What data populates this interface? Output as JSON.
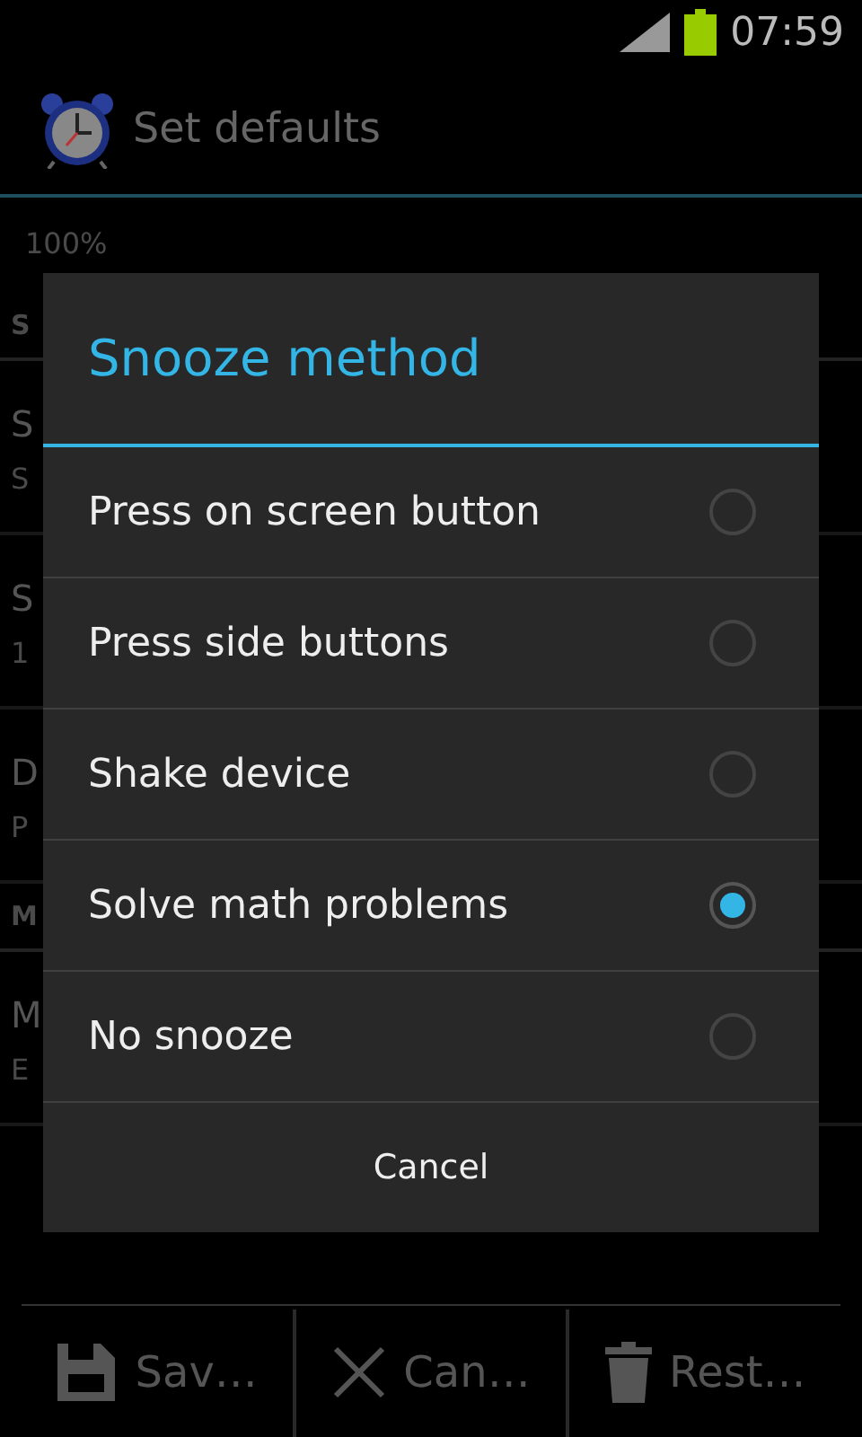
{
  "status_bar": {
    "time": "07:59"
  },
  "action_bar": {
    "title": "Set defaults"
  },
  "background_list": [
    {
      "kind": "item",
      "summary": "100%"
    },
    {
      "kind": "header",
      "title": "S"
    },
    {
      "kind": "item",
      "title": "S",
      "summary": "S"
    },
    {
      "kind": "item",
      "title": "S",
      "summary": "1"
    },
    {
      "kind": "item",
      "title": "D",
      "summary": "P"
    },
    {
      "kind": "header",
      "title": "M"
    },
    {
      "kind": "item",
      "title": "M",
      "summary": "E"
    }
  ],
  "dialog": {
    "title": "Snooze method",
    "options": [
      {
        "label": "Press on screen button",
        "selected": false
      },
      {
        "label": "Press side buttons",
        "selected": false
      },
      {
        "label": "Shake device",
        "selected": false
      },
      {
        "label": "Solve math problems",
        "selected": true
      },
      {
        "label": "No snooze",
        "selected": false
      }
    ],
    "cancel": "Cancel"
  },
  "bottom_bar": [
    {
      "kind": "save",
      "label": "Sav…"
    },
    {
      "kind": "cancel",
      "label": "Can…"
    },
    {
      "kind": "restore",
      "label": "Rest…"
    }
  ]
}
